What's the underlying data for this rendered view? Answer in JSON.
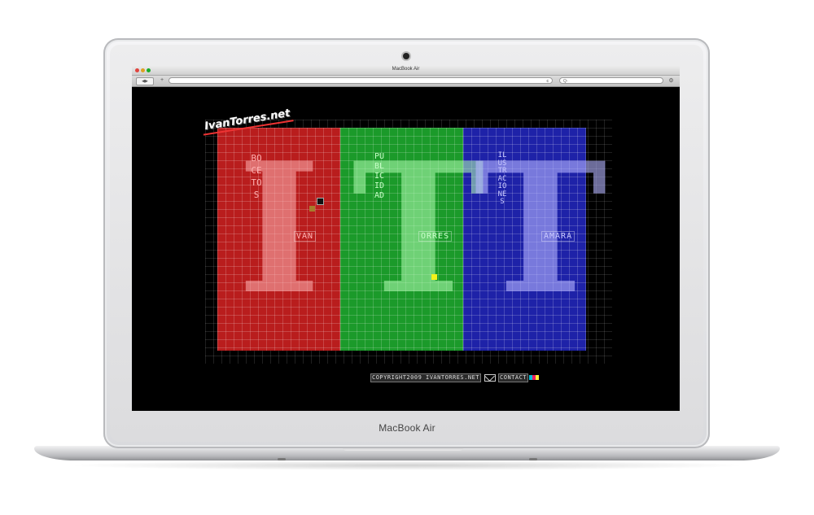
{
  "device": {
    "brand_label": "MacBook Air"
  },
  "browser": {
    "window_title": "MacBook Air",
    "back_label": "◀",
    "forward_label": "▶",
    "add_label": "+",
    "reload_label": "c",
    "search_placeholder": "Q-",
    "settings_label": "⚙"
  },
  "site": {
    "logo_text": "IvanTorres.net",
    "letters": [
      "I",
      "T",
      "T"
    ],
    "panels": [
      {
        "vertical": "BOCETOS",
        "horizontal": "VAN",
        "color": "#b91d1d"
      },
      {
        "vertical": "PUBLICIDAD",
        "horizontal": "ORRES",
        "color": "#1b9a2a"
      },
      {
        "vertical": "ILUSTRACIONES",
        "horizontal": "AMARA",
        "color": "#1e22a8"
      }
    ],
    "footer": {
      "copyright": "COPYRIGHT2009 IVANTORRES.NET",
      "contact": "CONTACT"
    }
  }
}
